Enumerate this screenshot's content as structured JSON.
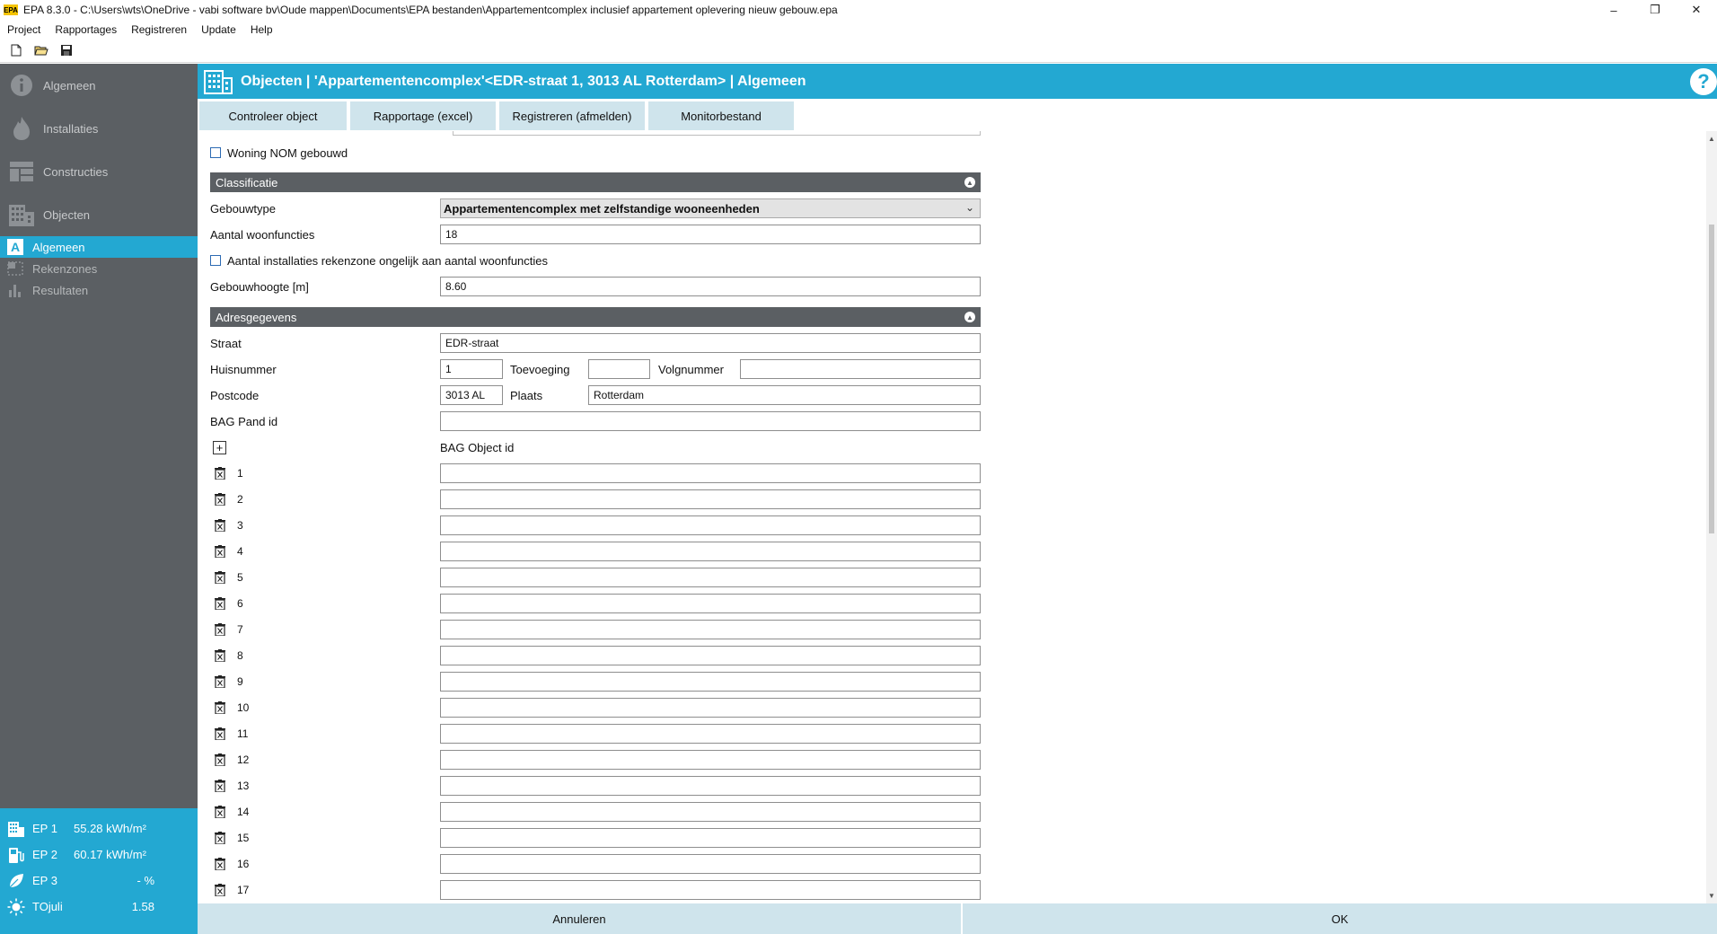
{
  "window": {
    "app_icon": "EPA",
    "title": "EPA 8.3.0 - C:\\Users\\wts\\OneDrive - vabi software bv\\Oude mappen\\Documents\\EPA bestanden\\Appartementcomplex inclusief appartement oplevering nieuw gebouw.epa",
    "minimize": "–",
    "restore": "❐",
    "close": "✕"
  },
  "menu": [
    "Project",
    "Rapportages",
    "Registreren",
    "Update",
    "Help"
  ],
  "toolbar_icons": [
    "new-file-icon",
    "open-folder-icon",
    "save-disk-icon"
  ],
  "sidebar": {
    "main": [
      {
        "label": "Algemeen",
        "icon": "info-icon"
      },
      {
        "label": "Installaties",
        "icon": "flame-icon"
      },
      {
        "label": "Constructies",
        "icon": "wall-icon"
      },
      {
        "label": "Objecten",
        "icon": "building-icon"
      }
    ],
    "sub": [
      {
        "label": "Algemeen",
        "icon": "letter-a-icon",
        "glyph": "A",
        "active": true
      },
      {
        "label": "Rekenzones",
        "icon": "zones-icon",
        "active": false
      },
      {
        "label": "Resultaten",
        "icon": "bar-chart-icon",
        "active": false
      }
    ],
    "results": [
      {
        "label": "EP 1",
        "value": "55.28 kWh/m²",
        "icon": "building-icon"
      },
      {
        "label": "EP 2",
        "value": "60.17 kWh/m²",
        "icon": "fuel-pump-icon"
      },
      {
        "label": "EP 3",
        "value": "- %",
        "icon": "leaf-icon"
      },
      {
        "label": "TOjuli",
        "value": "1.58",
        "icon": "sun-icon"
      }
    ]
  },
  "header": {
    "title": "Objecten | 'Appartementencomplex'<EDR-straat 1, 3013 AL Rotterdam> | Algemeen",
    "help": "?"
  },
  "tabs": [
    "Controleer object",
    "Rapportage (excel)",
    "Registreren (afmelden)",
    "Monitorbestand"
  ],
  "form": {
    "woning_nom_label": "Woning NOM gebouwd",
    "classificatie": {
      "section_title": "Classificatie",
      "gebouwtype_label": "Gebouwtype",
      "gebouwtype_value": "Appartementencomplex met zelfstandige wooneenheden",
      "woonfuncties_label": "Aantal woonfuncties",
      "woonfuncties_value": "18",
      "installaties_label": "Aantal installaties rekenzone ongelijk aan aantal woonfuncties",
      "hoogte_label": "Gebouwhoogte [m]",
      "hoogte_value": "8.60"
    },
    "adres": {
      "section_title": "Adresgegevens",
      "straat_label": "Straat",
      "straat_value": "EDR-straat",
      "huisnummer_label": "Huisnummer",
      "huisnummer_value": "1",
      "toevoeging_label": "Toevoeging",
      "toevoeging_value": "",
      "volgnummer_label": "Volgnummer",
      "volgnummer_value": "",
      "postcode_label": "Postcode",
      "postcode_value": "3013 AL",
      "plaats_label": "Plaats",
      "plaats_value": "Rotterdam",
      "bag_pand_label": "BAG Pand id",
      "bag_pand_value": "",
      "bag_object_label": "BAG Object id",
      "add_icon": "+",
      "bag_object_rows": [
        "1",
        "2",
        "3",
        "4",
        "5",
        "6",
        "7",
        "8",
        "9",
        "10",
        "11",
        "12",
        "13",
        "14",
        "15",
        "16",
        "17"
      ]
    }
  },
  "footer": {
    "cancel": "Annuleren",
    "ok": "OK"
  },
  "colors": {
    "accent": "#23a8d2",
    "sidebar": "#5b5f63",
    "tab": "#cfe4ec"
  }
}
